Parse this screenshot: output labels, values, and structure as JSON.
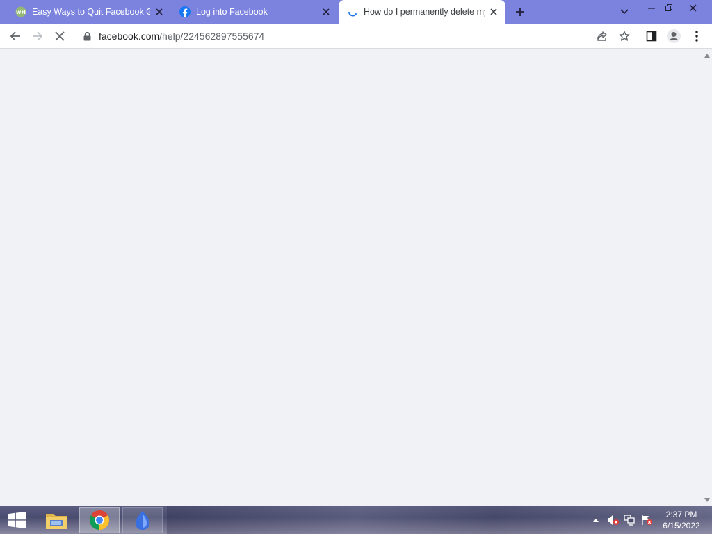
{
  "browser": {
    "tabs": [
      {
        "title": "Easy Ways to Quit Facebook Gra",
        "favicon": "wikihow-icon",
        "active": false
      },
      {
        "title": "Log into Facebook",
        "favicon": "facebook-icon",
        "active": false
      },
      {
        "title": "How do I permanently delete my",
        "favicon": "loading-spinner-icon",
        "active": true
      }
    ],
    "address": {
      "domain": "facebook.com",
      "path": "/help/224562897555674"
    }
  },
  "taskbar": {
    "time": "2:37 PM",
    "date": "6/15/2022",
    "items": [
      "file-explorer-icon",
      "chrome-icon",
      "app-icon"
    ]
  },
  "colors": {
    "tabstrip": "#7c83de",
    "page_bg": "#f0f2f5",
    "accent": "#1a73e8"
  }
}
